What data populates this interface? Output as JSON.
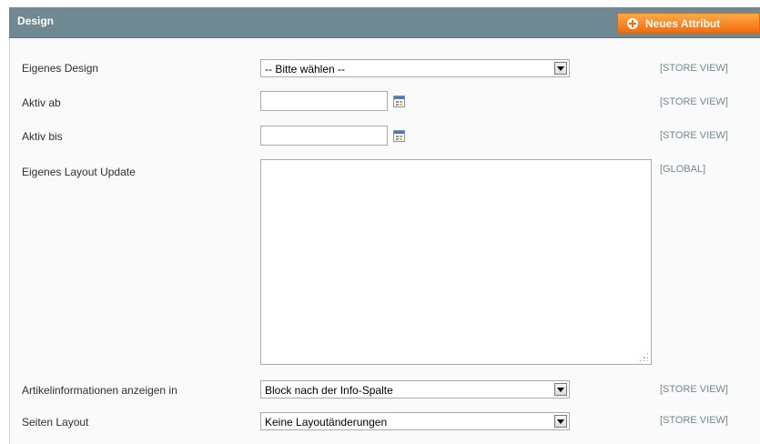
{
  "header": {
    "title": "Design",
    "button_label": "Neues Attribut"
  },
  "fields": {
    "custom_design": {
      "label": "Eigenes Design",
      "value": "-- Bitte wählen --",
      "scope": "[STORE VIEW]"
    },
    "active_from": {
      "label": "Aktiv ab",
      "value": "",
      "scope": "[STORE VIEW]"
    },
    "active_to": {
      "label": "Aktiv bis",
      "value": "",
      "scope": "[STORE VIEW]"
    },
    "layout_update": {
      "label": "Eigenes Layout Update",
      "value": "",
      "scope": "[GLOBAL]"
    },
    "options_container": {
      "label": "Artikelinformationen anzeigen in",
      "value": "Block nach der Info-Spalte",
      "scope": "[STORE VIEW]"
    },
    "page_layout": {
      "label": "Seiten Layout",
      "value": "Keine Layoutänderungen",
      "scope": "[STORE VIEW]"
    }
  },
  "colors": {
    "header_bg": "#6f8992",
    "button_bg": "#f26a0b",
    "scope_text": "#6f8992"
  }
}
